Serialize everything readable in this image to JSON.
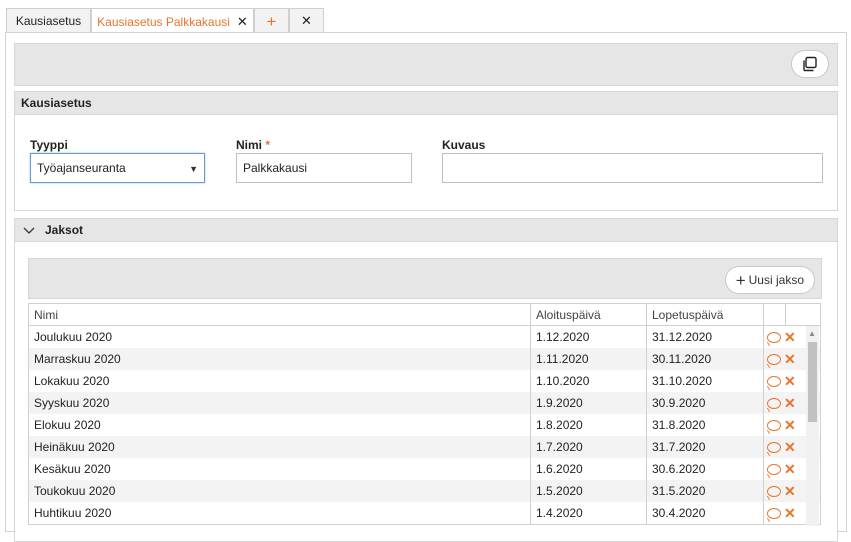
{
  "tabs": [
    {
      "label": "Kausiasetus"
    },
    {
      "label": "Kausiasetus Palkkakausi"
    }
  ],
  "tab_add_icon": "+",
  "tab_close_icon": "✕",
  "section": {
    "title": "Kausiasetus"
  },
  "form": {
    "type_label": "Tyyppi",
    "type_value": "Työajanseuranta",
    "name_label": "Nimi",
    "required_mark": "*",
    "name_value": "Palkkakausi",
    "desc_label": "Kuvaus",
    "desc_value": ""
  },
  "periods": {
    "title": "Jaksot",
    "new_button_label": "Uusi jakso",
    "columns": [
      "Nimi",
      "Aloituspäivä",
      "Lopetuspäivä"
    ],
    "rows": [
      {
        "name": "Joulukuu 2020",
        "start": "1.12.2020",
        "end": "31.12.2020"
      },
      {
        "name": "Marraskuu 2020",
        "start": "1.11.2020",
        "end": "30.11.2020"
      },
      {
        "name": "Lokakuu 2020",
        "start": "1.10.2020",
        "end": "31.10.2020"
      },
      {
        "name": "Syyskuu 2020",
        "start": "1.9.2020",
        "end": "30.9.2020"
      },
      {
        "name": "Elokuu 2020",
        "start": "1.8.2020",
        "end": "31.8.2020"
      },
      {
        "name": "Heinäkuu 2020",
        "start": "1.7.2020",
        "end": "31.7.2020"
      },
      {
        "name": "Kesäkuu 2020",
        "start": "1.6.2020",
        "end": "30.6.2020"
      },
      {
        "name": "Toukokuu 2020",
        "start": "1.5.2020",
        "end": "31.5.2020"
      },
      {
        "name": "Huhtikuu 2020",
        "start": "1.4.2020",
        "end": "30.4.2020"
      }
    ]
  },
  "colors": {
    "accent": "#e8742c",
    "header_bg": "#e6e6e6"
  }
}
